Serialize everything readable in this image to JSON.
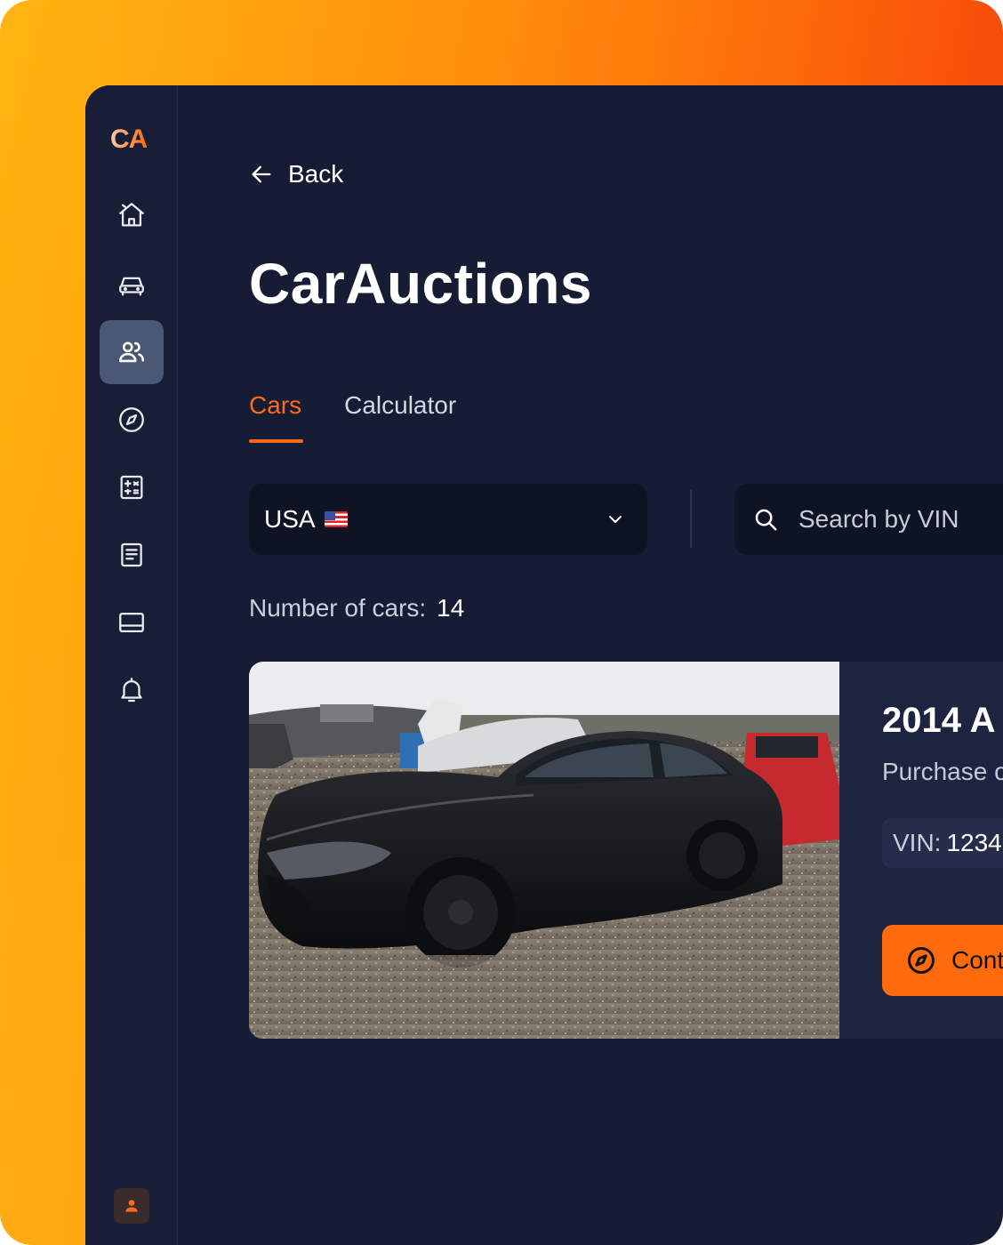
{
  "app": {
    "logo": "CA",
    "title": "CarAuctions"
  },
  "sidebar": {
    "items": [
      {
        "name": "home"
      },
      {
        "name": "cars"
      },
      {
        "name": "users",
        "active": true
      },
      {
        "name": "compass"
      },
      {
        "name": "calculator"
      },
      {
        "name": "documents"
      },
      {
        "name": "payments"
      },
      {
        "name": "notifications"
      }
    ]
  },
  "header": {
    "back_label": "Back"
  },
  "tabs": [
    {
      "label": "Cars",
      "active": true
    },
    {
      "label": "Calculator",
      "active": false
    }
  ],
  "filters": {
    "country": "USA",
    "search_placeholder": "Search by VIN"
  },
  "results": {
    "label": "Number of cars:",
    "count": "14"
  },
  "car_card": {
    "title": "2014 A",
    "subtitle": "Purchase c",
    "vin_label": "VIN:",
    "vin_value": "1234",
    "cta_label": "Cont"
  },
  "colors": {
    "accent": "#ff6a1a",
    "app_background": "#161c33",
    "sidebar_active": "#4a5875",
    "frame_gradient_start": "#ffb511",
    "frame_gradient_end": "#f23a08"
  }
}
